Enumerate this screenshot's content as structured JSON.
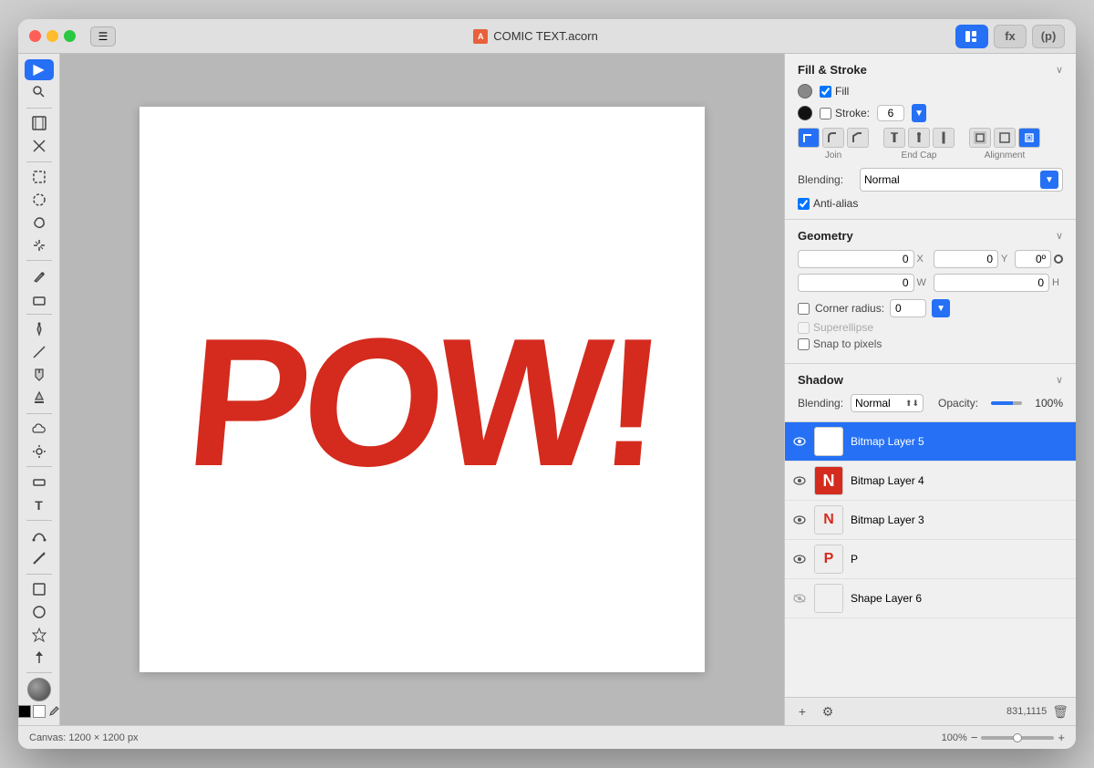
{
  "window": {
    "title": "COMIC TEXT.acorn",
    "canvas_size": "Canvas: 1200 × 1200 px",
    "zoom_level": "100%",
    "coordinates": "831,1115"
  },
  "titlebar": {
    "buttons": {
      "tool_icon": "🔨",
      "fx_label": "fx",
      "p_label": "(p)"
    },
    "sidebar_icon": "☰"
  },
  "toolbar": {
    "tools": [
      {
        "name": "selection",
        "icon": "▶",
        "active": true
      },
      {
        "name": "zoom",
        "icon": "🔍"
      },
      {
        "name": "crop",
        "icon": "⬜"
      },
      {
        "name": "transform",
        "icon": "✕"
      },
      {
        "name": "rect-select",
        "icon": "▭"
      },
      {
        "name": "ellipse-select",
        "icon": "◯"
      },
      {
        "name": "lasso",
        "icon": "⌒"
      },
      {
        "name": "magic-select",
        "icon": "✦"
      },
      {
        "name": "brush",
        "icon": "✏"
      },
      {
        "name": "eraser",
        "icon": "⬜"
      },
      {
        "name": "pen",
        "icon": "✒"
      },
      {
        "name": "line",
        "icon": "/"
      },
      {
        "name": "paint-bucket",
        "icon": "🪣"
      },
      {
        "name": "stamp",
        "icon": "⬡"
      },
      {
        "name": "cloud",
        "icon": "☁"
      },
      {
        "name": "sun",
        "icon": "☀"
      },
      {
        "name": "rect-shape",
        "icon": "▬"
      },
      {
        "name": "text",
        "icon": "T"
      },
      {
        "name": "bezier",
        "icon": "✒"
      },
      {
        "name": "line2",
        "icon": "/"
      },
      {
        "name": "rect2",
        "icon": "□"
      },
      {
        "name": "ellipse2",
        "icon": "○"
      },
      {
        "name": "star",
        "icon": "★"
      },
      {
        "name": "arrow",
        "icon": "↑"
      }
    ]
  },
  "fill_stroke": {
    "title": "Fill & Stroke",
    "fill_checked": true,
    "fill_label": "Fill",
    "stroke_label": "Stroke:",
    "stroke_value": "6",
    "join_label": "Join",
    "end_cap_label": "End Cap",
    "alignment_label": "Alignment",
    "blending_label": "Blending:",
    "blending_value": "Normal",
    "antialias_label": "Anti-alias",
    "antialias_checked": true
  },
  "geometry": {
    "title": "Geometry",
    "x_value": "0",
    "x_label": "X",
    "y_value": "0",
    "y_label": "Y",
    "angle_value": "0º",
    "w_value": "0",
    "w_label": "W",
    "h_value": "0",
    "h_label": "H",
    "corner_radius_label": "Corner radius:",
    "corner_radius_value": "0",
    "superellipse_label": "Superellipse",
    "snap_to_pixels_label": "Snap to pixels"
  },
  "shadow": {
    "title": "Shadow",
    "blending_label": "Blending:",
    "blending_value": "Normal",
    "opacity_label": "Opacity:",
    "opacity_value": "100%"
  },
  "layers": [
    {
      "name": "Bitmap Layer 5",
      "selected": true,
      "visible": true,
      "type": "empty"
    },
    {
      "name": "Bitmap Layer 4",
      "selected": false,
      "visible": true,
      "type": "red"
    },
    {
      "name": "Bitmap Layer 3",
      "selected": false,
      "visible": true,
      "type": "letter",
      "letter": "N"
    },
    {
      "name": "P",
      "selected": false,
      "visible": true,
      "type": "letter-red",
      "letter": "P"
    },
    {
      "name": "Shape Layer 6",
      "selected": false,
      "visible": false,
      "type": "shape"
    }
  ],
  "layers_toolbar": {
    "add_label": "+",
    "settings_label": "⚙",
    "coordinates": "831,1115",
    "trash_icon": "🗑"
  },
  "canvas": {
    "pow_text": "POW!"
  }
}
